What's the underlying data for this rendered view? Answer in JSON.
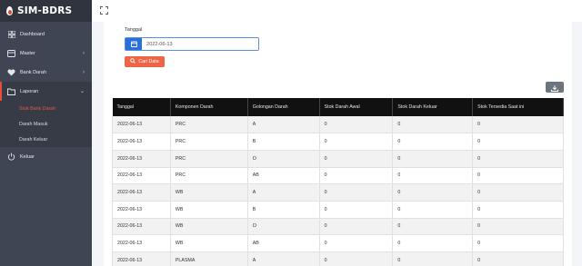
{
  "brand": {
    "title": "SIM-BDRS"
  },
  "sidebar": {
    "items": [
      {
        "label": "Dashboard",
        "icon": "dashboard-icon",
        "chevron": ""
      },
      {
        "label": "Master",
        "icon": "database-icon",
        "chevron": "›"
      },
      {
        "label": "Bank Darah",
        "icon": "heart-icon",
        "chevron": "›"
      },
      {
        "label": "Laporan",
        "icon": "folder-icon",
        "chevron": "⌄"
      }
    ],
    "submenu": [
      {
        "label": "Stok Bank Darah"
      },
      {
        "label": "Darah Masuk"
      },
      {
        "label": "Darah Keluar"
      }
    ],
    "logout": {
      "label": "Keluar",
      "icon": "power-icon"
    }
  },
  "colors": {
    "sidebar": "#3f4552",
    "accent": "#e74c3c",
    "primary": "#2a6fdb",
    "search_button": "#ef6445"
  },
  "filter": {
    "label": "Tanggal",
    "date_value": "2022-06-13",
    "button_label": "Cari Data"
  },
  "table": {
    "headers": [
      "Tanggal",
      "Komponen Darah",
      "Golongan Darah",
      "Stok Darah Awal",
      "Stok Darah Keluar",
      "Stok Tersedia Saat ini"
    ],
    "rows": [
      [
        "2022-06-13",
        "PRC",
        "A",
        "0",
        "0",
        "0"
      ],
      [
        "2022-06-13",
        "PRC",
        "B",
        "0",
        "0",
        "0"
      ],
      [
        "2022-06-13",
        "PRC",
        "O",
        "0",
        "0",
        "0"
      ],
      [
        "2022-06-13",
        "PRC",
        "AB",
        "0",
        "0",
        "0"
      ],
      [
        "2022-06-13",
        "WB",
        "A",
        "0",
        "0",
        "0"
      ],
      [
        "2022-06-13",
        "WB",
        "B",
        "0",
        "0",
        "0"
      ],
      [
        "2022-06-13",
        "WB",
        "O",
        "0",
        "0",
        "0"
      ],
      [
        "2022-06-13",
        "WB",
        "AB",
        "0",
        "0",
        "0"
      ],
      [
        "2022-06-13",
        "PLASMA",
        "A",
        "0",
        "0",
        "0"
      ]
    ]
  }
}
